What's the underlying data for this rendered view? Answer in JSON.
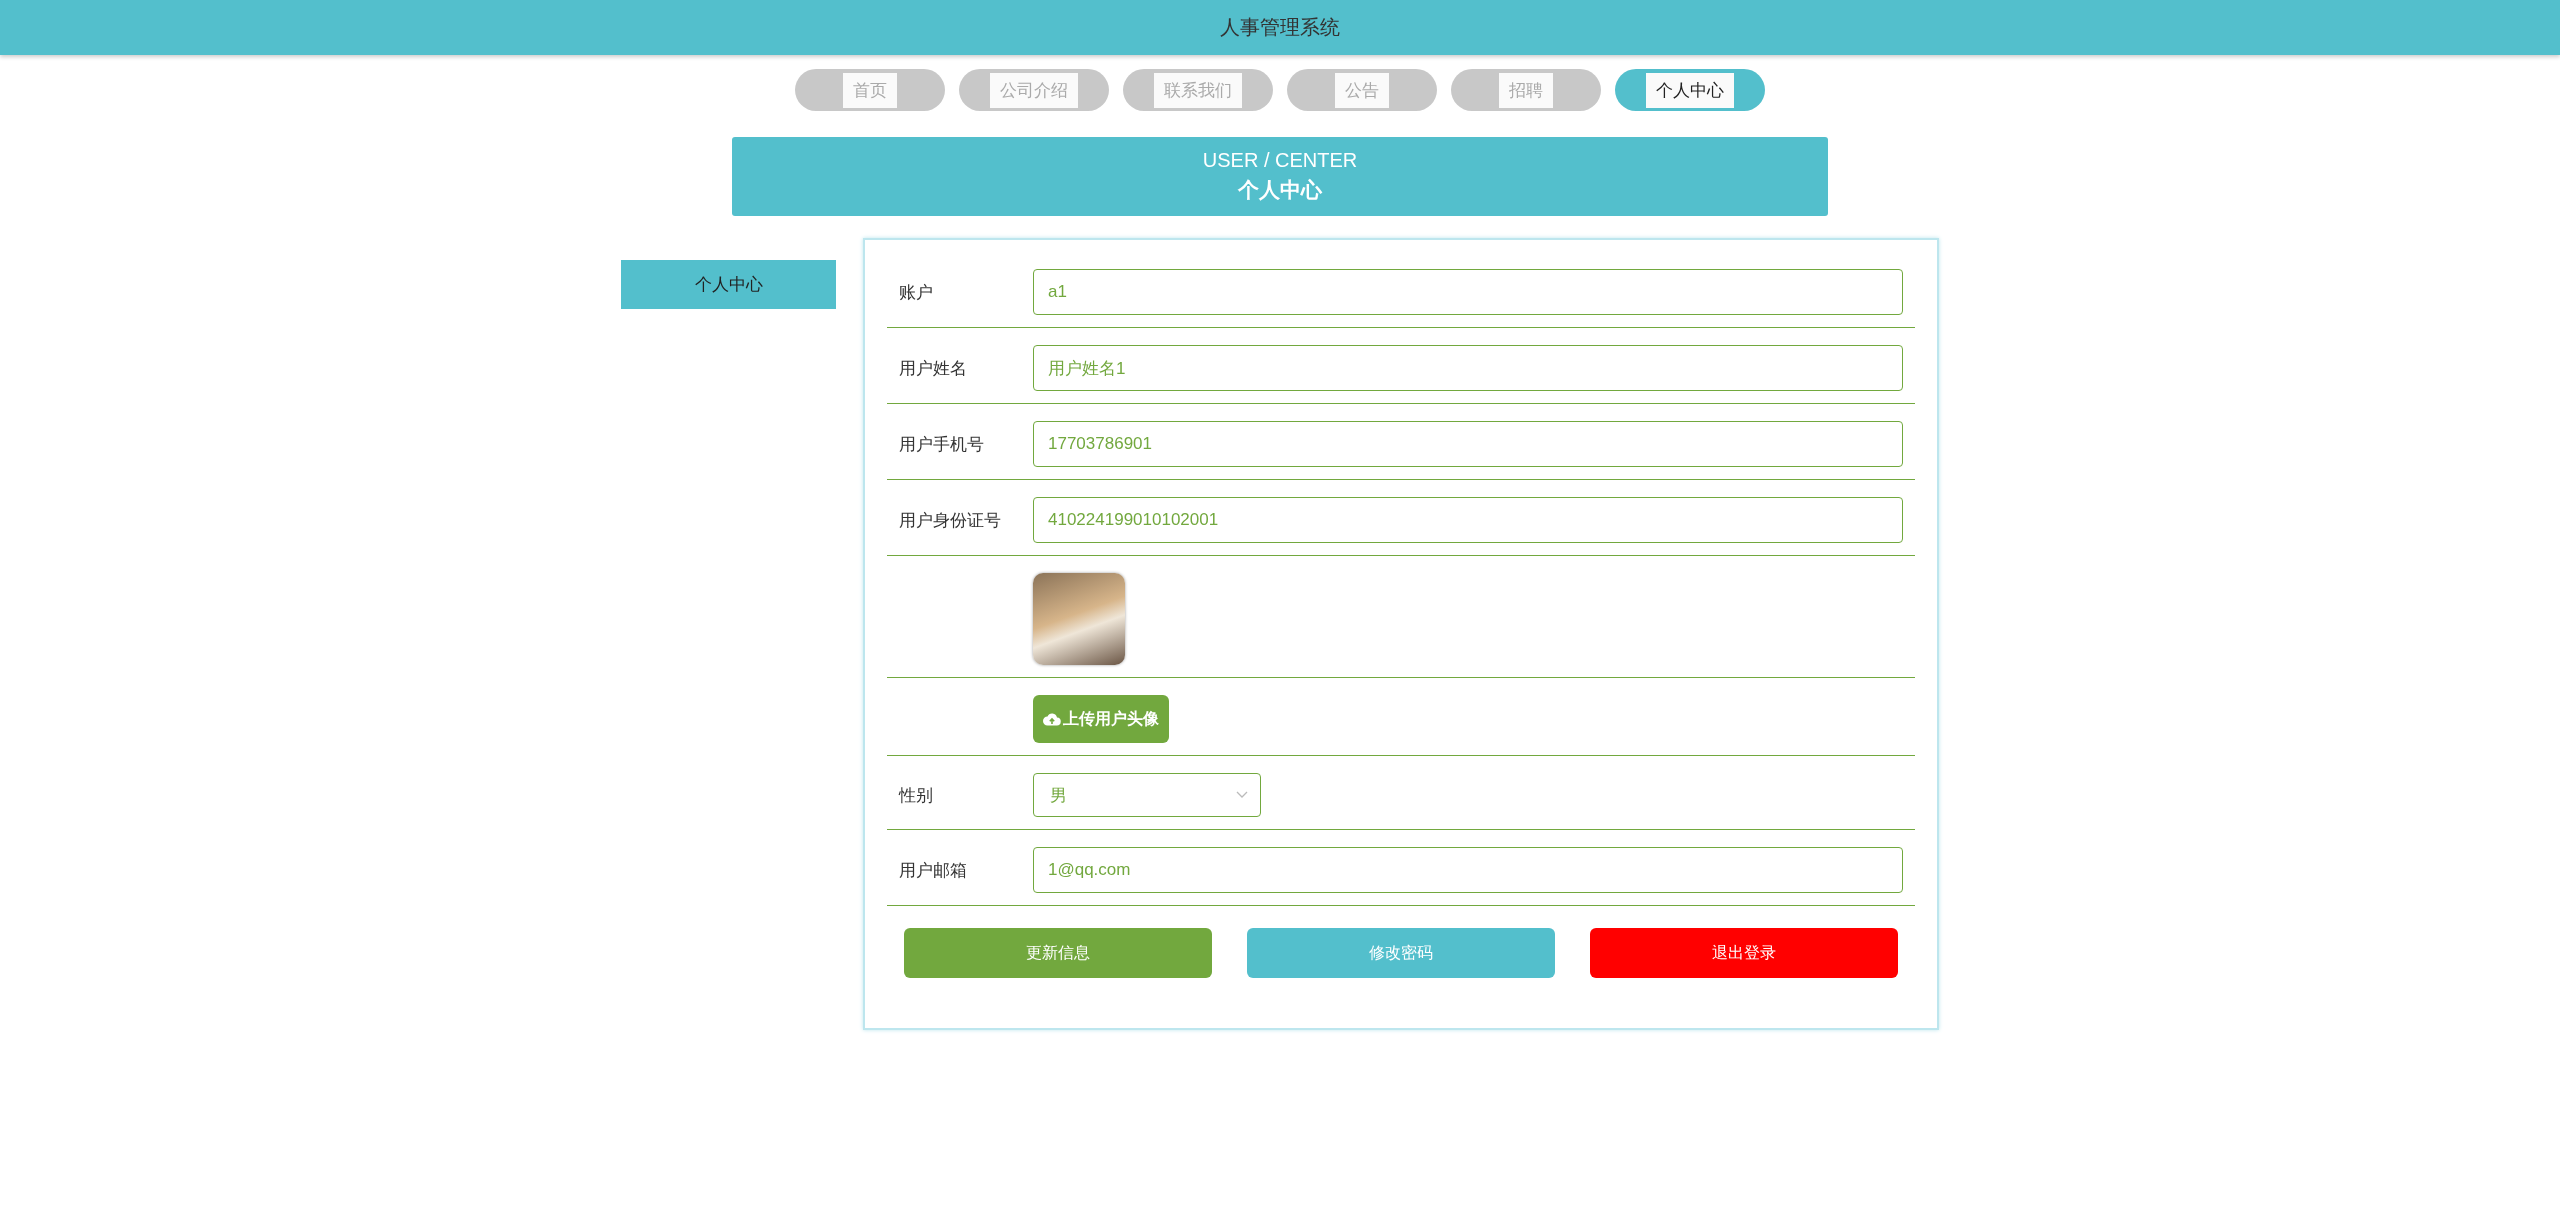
{
  "header": {
    "title": "人事管理系统"
  },
  "nav": [
    {
      "label": "首页",
      "selected": false
    },
    {
      "label": "公司介绍",
      "selected": false
    },
    {
      "label": "联系我们",
      "selected": false
    },
    {
      "label": "公告",
      "selected": false
    },
    {
      "label": "招聘",
      "selected": false
    },
    {
      "label": "个人中心",
      "selected": true
    }
  ],
  "banner": {
    "subtitle": "USER / CENTER",
    "title": "个人中心"
  },
  "sidebar": {
    "items": [
      {
        "label": "个人中心",
        "selected": true
      }
    ]
  },
  "form": {
    "fields": [
      {
        "kind": "text",
        "label": "账户",
        "value": "a1"
      },
      {
        "kind": "text",
        "label": "用户姓名",
        "value": "用户姓名1"
      },
      {
        "kind": "text",
        "label": "用户手机号",
        "value": "17703786901"
      },
      {
        "kind": "text",
        "label": "用户身份证号",
        "value": "410224199010102001"
      },
      {
        "kind": "avatar"
      },
      {
        "kind": "upload",
        "button": "上传用户头像"
      },
      {
        "kind": "select",
        "label": "性别",
        "value": "男"
      },
      {
        "kind": "text",
        "label": "用户邮箱",
        "value": "1@qq.com"
      }
    ],
    "buttons": [
      {
        "label": "更新信息",
        "kind": "update"
      },
      {
        "label": "修改密码",
        "kind": "password"
      },
      {
        "label": "退出登录",
        "kind": "logout"
      }
    ]
  }
}
